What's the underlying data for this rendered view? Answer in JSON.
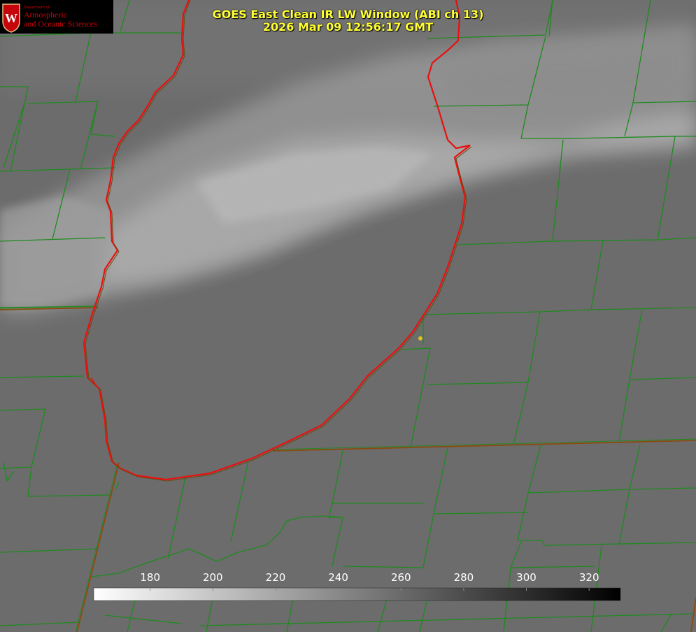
{
  "title": {
    "line1": "GOES East Clean IR LW Window (ABI ch 13)",
    "line2": "2026 Mar 09 12:56:17 GMT"
  },
  "logo": {
    "dept": "Department of",
    "line1": "Atmospheric",
    "line2": "and Oceanic Sciences",
    "emblem_letter": "W"
  },
  "colorbar": {
    "min": 162,
    "max": 330,
    "ticks": [
      "180",
      "200",
      "220",
      "240",
      "260",
      "280",
      "300",
      "320"
    ],
    "tick_values": [
      180,
      200,
      220,
      240,
      260,
      280,
      300,
      320
    ],
    "gradient": [
      "#ffffff",
      "#000000"
    ]
  },
  "colors": {
    "background_gray": "#6e6e6e",
    "cloud_gray": "#a8a8a8",
    "county_lines": "#1f8a1f",
    "state_lines": "#8a4a10",
    "lake_outline": "#e81010",
    "title_text": "#ffff33",
    "logo_red": "#c5050c",
    "marker": "#e0c020"
  }
}
